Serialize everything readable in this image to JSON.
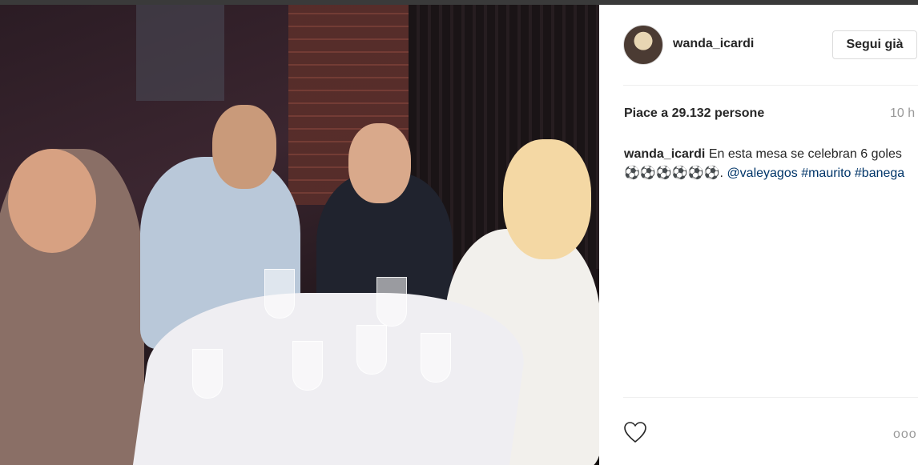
{
  "post": {
    "username": "wanda_icardi",
    "follow_label": "Segui già",
    "likes_text": "Piace a 29.132 persone",
    "time_text": "10 h",
    "caption": {
      "username": "wanda_icardi",
      "text": "En esta mesa se celebran 6 goles ⚽⚽⚽⚽⚽⚽.",
      "mention": "@valeyagos",
      "hashtag1": "#maurito",
      "hashtag2": "#banega"
    },
    "more_label": "ooo"
  },
  "icons": {
    "like": "heart-icon",
    "more": "more-options-icon"
  },
  "colors": {
    "link": "#003569",
    "text": "#262626",
    "muted": "#999999",
    "border": "#dbdbdb"
  }
}
